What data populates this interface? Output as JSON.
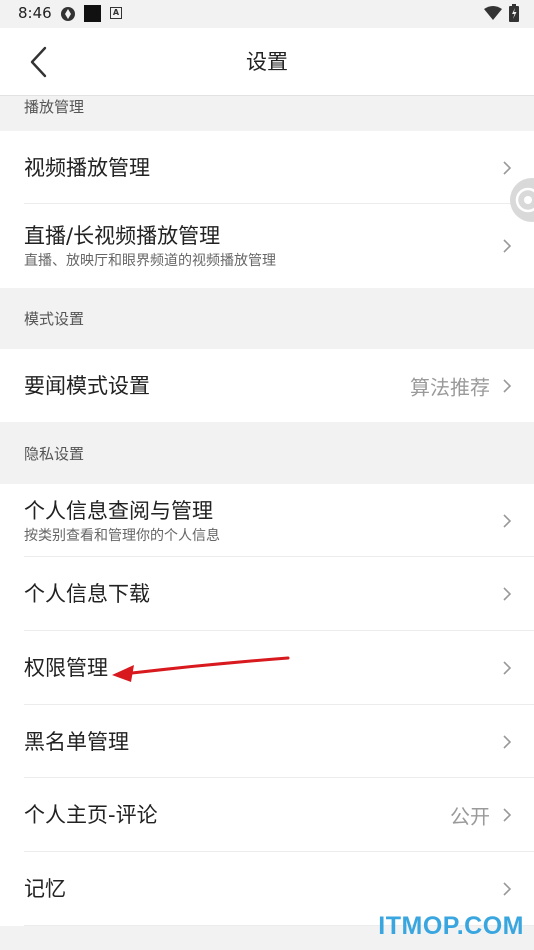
{
  "status_bar": {
    "time": "8:46",
    "badge_letter": "A"
  },
  "header": {
    "title": "设置"
  },
  "sections": [
    {
      "title": "播放管理",
      "rows": [
        {
          "title": "视频播放管理"
        },
        {
          "title": "直播/长视频播放管理",
          "subtitle": "直播、放映厅和眼界频道的视频播放管理"
        }
      ]
    },
    {
      "title": "模式设置",
      "rows": [
        {
          "title": "要闻模式设置",
          "value": "算法推荐"
        }
      ]
    },
    {
      "title": "隐私设置",
      "rows": [
        {
          "title": "个人信息查阅与管理",
          "subtitle": "按类别查看和管理你的个人信息"
        },
        {
          "title": "个人信息下载"
        },
        {
          "title": "权限管理"
        },
        {
          "title": "黑名单管理"
        },
        {
          "title": "个人主页-评论",
          "value": "公开"
        },
        {
          "title": "记忆"
        }
      ]
    }
  ],
  "watermark": "ITMOP.COM",
  "colors": {
    "background": "#f2f2f2",
    "arrow": "#d8191e",
    "watermark": "#3aa6df"
  }
}
